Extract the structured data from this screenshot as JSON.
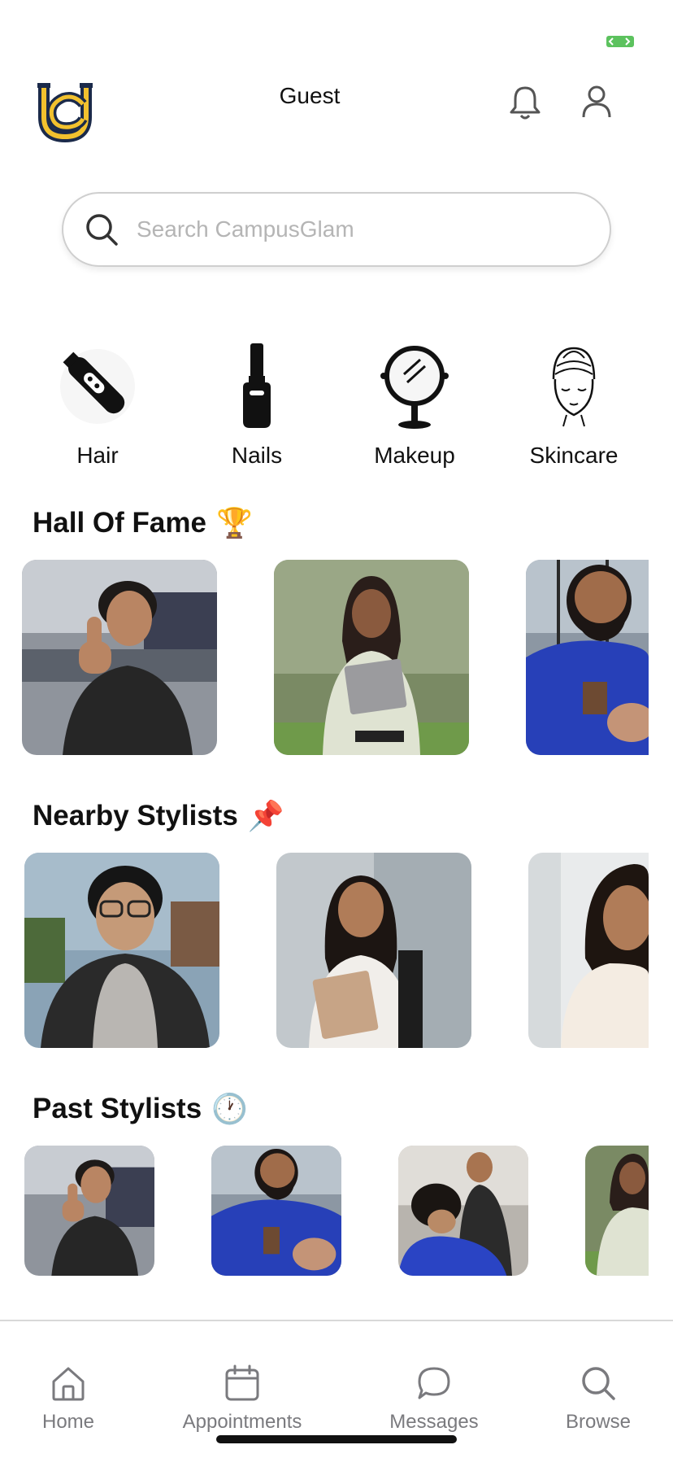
{
  "header": {
    "user_name": "Guest"
  },
  "search": {
    "placeholder": "Search CampusGlam",
    "value": ""
  },
  "categories": [
    {
      "label": "Hair",
      "icon": "hair-clipper-icon"
    },
    {
      "label": "Nails",
      "icon": "nail-polish-icon"
    },
    {
      "label": "Makeup",
      "icon": "makeup-mirror-icon"
    },
    {
      "label": "Skincare",
      "icon": "face-towel-icon"
    }
  ],
  "sections": {
    "hall_of_fame": {
      "title": "Hall Of Fame",
      "emoji": "🏆"
    },
    "nearby": {
      "title": "Nearby Stylists",
      "emoji": "📌"
    },
    "past": {
      "title": "Past Stylists",
      "emoji": "🕐"
    }
  },
  "tabs": [
    {
      "label": "Home",
      "icon": "home-icon"
    },
    {
      "label": "Appointments",
      "icon": "calendar-icon"
    },
    {
      "label": "Messages",
      "icon": "chat-bubble-icon"
    },
    {
      "label": "Browse",
      "icon": "search-icon"
    }
  ],
  "colors": {
    "logo_gold": "#f2c12e",
    "logo_navy": "#1b2a4a",
    "battery_green": "#5cc25e",
    "tab_gray": "#7a7a7e"
  }
}
